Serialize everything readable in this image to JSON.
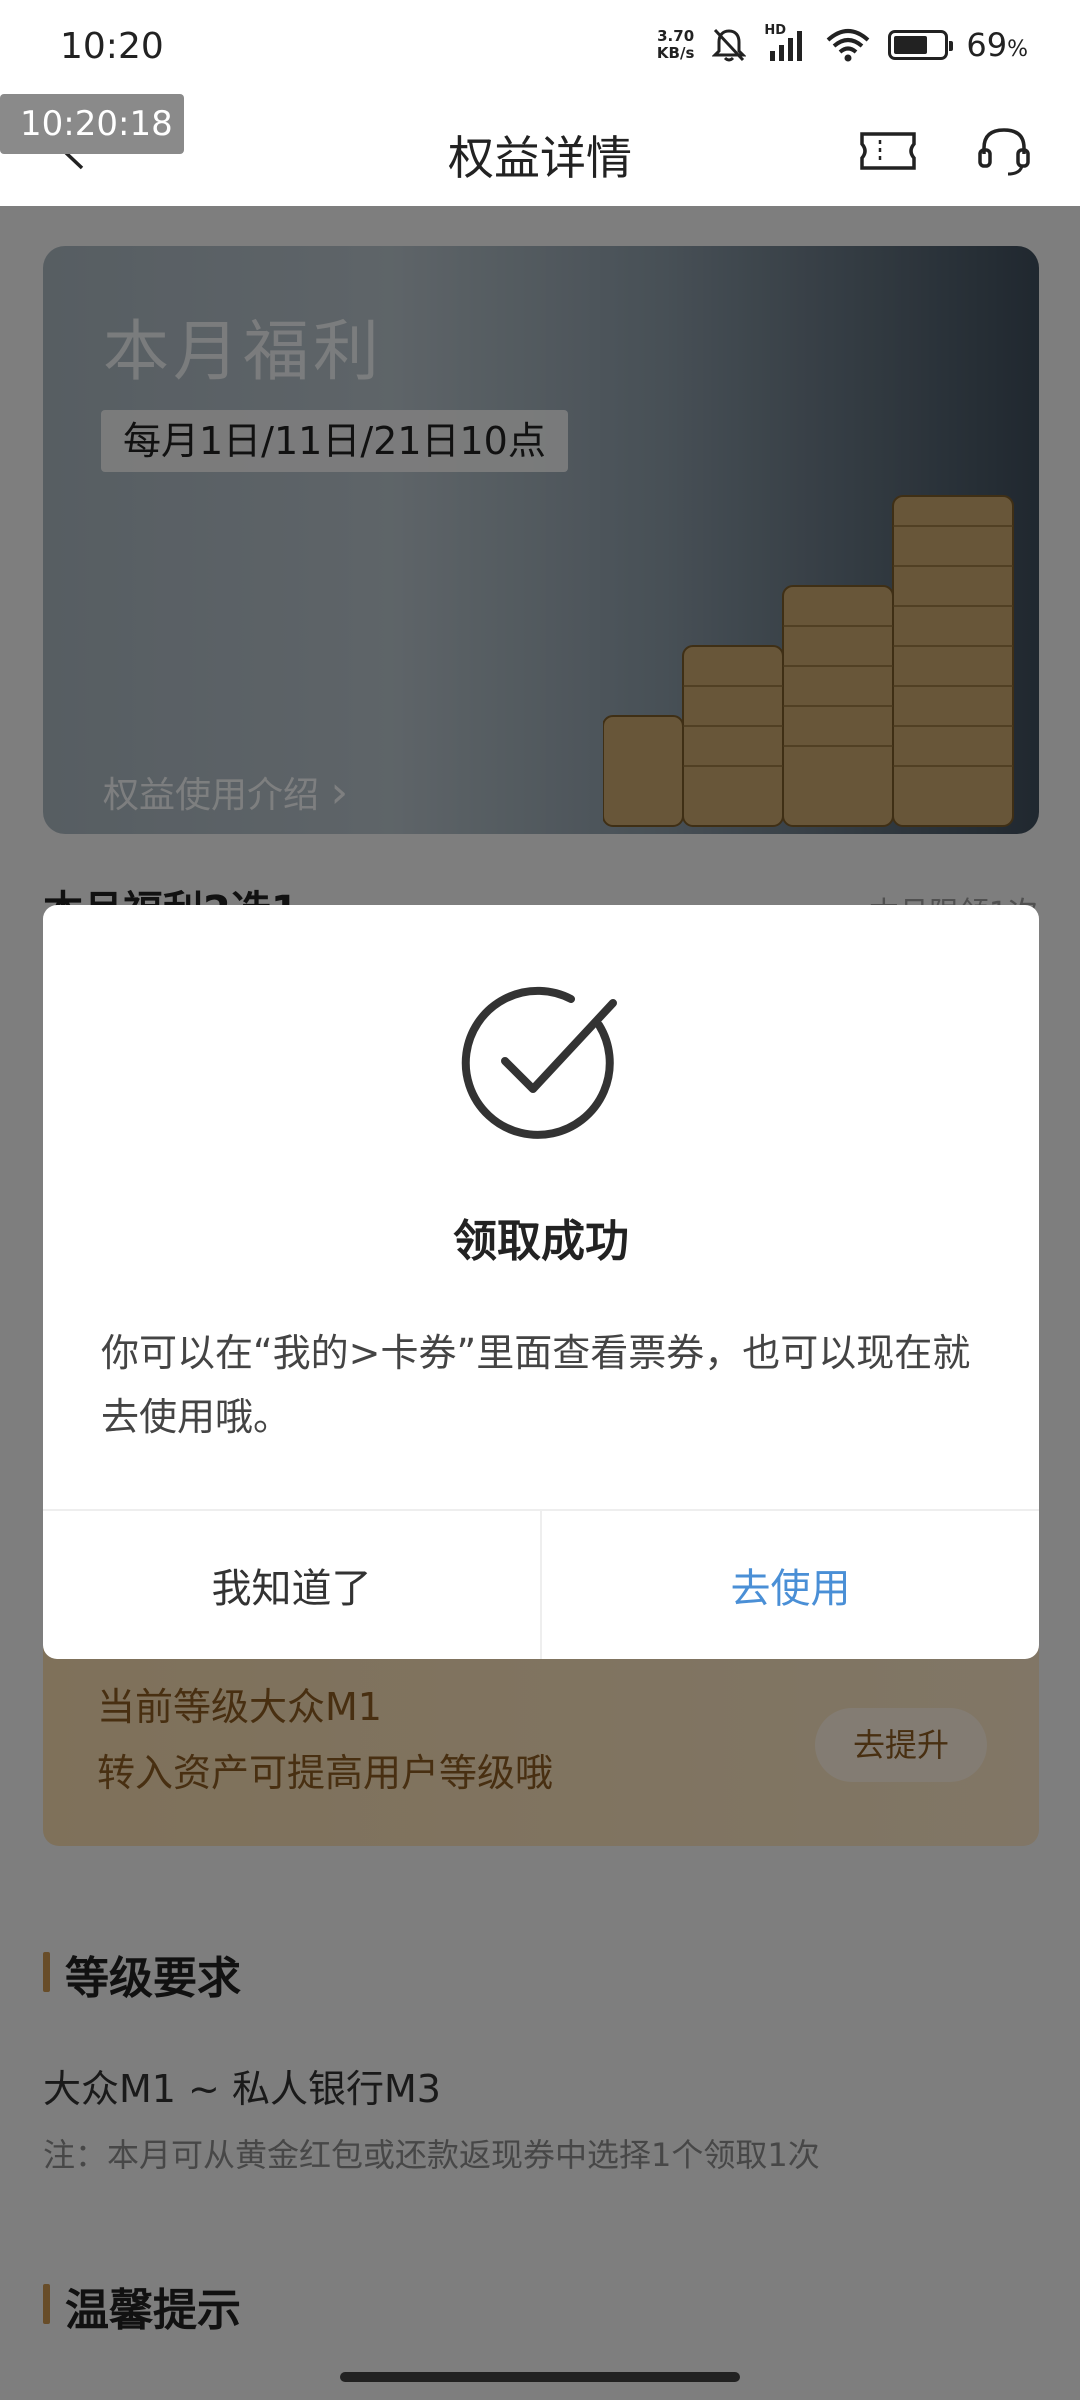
{
  "status_bar": {
    "time": "10:20",
    "net_speed_value": "3.70",
    "net_speed_unit": "KB/s",
    "network_badge": "HD",
    "battery_percent": "69",
    "battery_suffix": "%",
    "icons": [
      "mute-bell-icon",
      "signal-icon",
      "wifi-icon",
      "battery-icon"
    ]
  },
  "time_overlay": "10:20:18",
  "header": {
    "title": "权益详情",
    "icons": [
      "back-icon",
      "ticket-icon",
      "customer-service-icon"
    ]
  },
  "banner": {
    "title": "本月福利",
    "schedule_badge": "每月1日/11日/21日10点",
    "intro_link": "权益使用介绍",
    "link_chevron": "›"
  },
  "partial_section": {
    "heading": "本月福利2选1",
    "right_text": "本月限领1次"
  },
  "dialog": {
    "title": "领取成功",
    "body": "你可以在“我的>卡券”里面查看票券，也可以现在就去使用哦。",
    "secondary_button": "我知道了",
    "primary_button": "去使用"
  },
  "level_card": {
    "line1": "当前等级大众M1",
    "line2": "转入资产可提高用户等级哦",
    "button": "去提升"
  },
  "requirements": {
    "heading": "等级要求",
    "range": "大众M1 ~ 私人银行M3",
    "note": "注：本月可从黄金红包或还款返现券中选择1个领取1次"
  },
  "tips": {
    "heading": "温馨提示"
  },
  "colors": {
    "accent_gold": "#c8954f",
    "primary_link": "#4a8fd6",
    "level_text": "#8a5a22"
  }
}
